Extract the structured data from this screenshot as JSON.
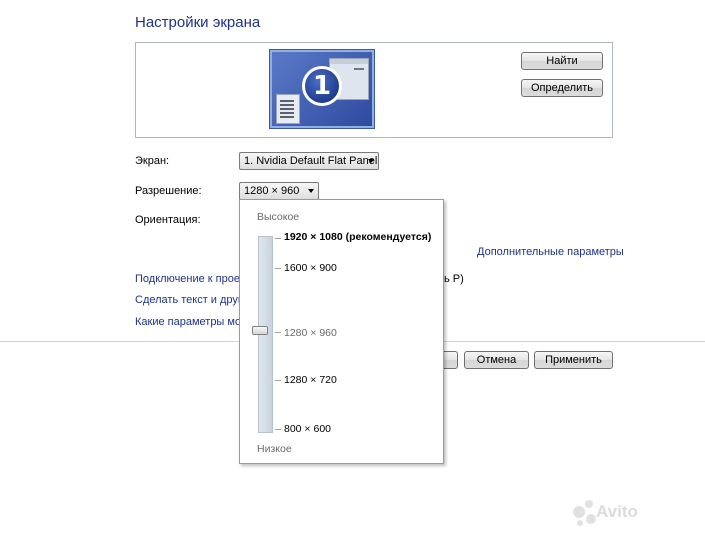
{
  "window": {
    "title": "Настройки экрана"
  },
  "preview": {
    "monitor_number": "1",
    "identify_button": "Найти",
    "detect_button": "Определить"
  },
  "settings": {
    "display_label": "Экран:",
    "display_value": "1. Nvidia Default Flat Panel",
    "resolution_label": "Разрешение:",
    "resolution_value": "1280 × 960",
    "orientation_label": "Ориентация:"
  },
  "resolution_dropdown": {
    "high_label": "Высокое",
    "low_label": "Низкое",
    "options": [
      {
        "text": "1920 × 1080 (рекомендуется)"
      },
      {
        "text": "1600 × 900"
      },
      {
        "text": "1280 × 960"
      },
      {
        "text": "1280 × 720"
      },
      {
        "text": "800 × 600"
      }
    ],
    "selected_index": 2
  },
  "links": {
    "advanced": "Дополнительные параметры",
    "connect_partial": "Подключение к проек",
    "connect_suffix": "ь P)",
    "text_size_partial": "Сделать текст и други",
    "which_settings_partial": "Какие параметры мон"
  },
  "footer": {
    "cancel_button": "Отмена",
    "apply_button": "Применить"
  },
  "watermark": {
    "text": "Avito"
  }
}
